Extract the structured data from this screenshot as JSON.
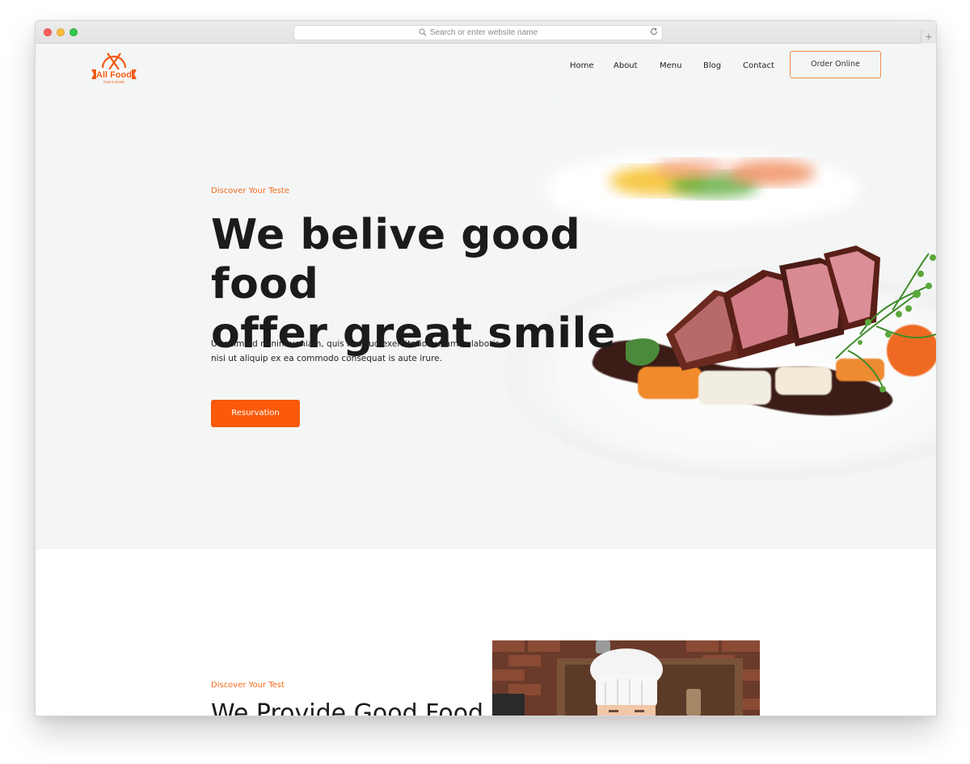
{
  "browser": {
    "url_placeholder": "Search or enter website name",
    "new_tab": "+"
  },
  "header": {
    "logo_text": "All Food",
    "logo_subtext": "Food & Drinks",
    "nav": [
      "Home",
      "About",
      "Menu",
      "Blog",
      "Contact"
    ],
    "order_label": "Order Online"
  },
  "hero": {
    "eyebrow": "Discover Your Teste",
    "title_line1": "We belive good food",
    "title_line2": "offer great smile",
    "description": "Ut enim ad minim veniam, quis nostrud exercitation ullamco laboris nisi ut aliquip ex ea commodo consequat is aute irure.",
    "button_label": "Resurvation"
  },
  "section2": {
    "eyebrow": "Discover Your Test",
    "title": "We Provide Good Food"
  },
  "colors": {
    "accent": "#fa5a0a",
    "hero_bg": "#f4f6f6"
  }
}
